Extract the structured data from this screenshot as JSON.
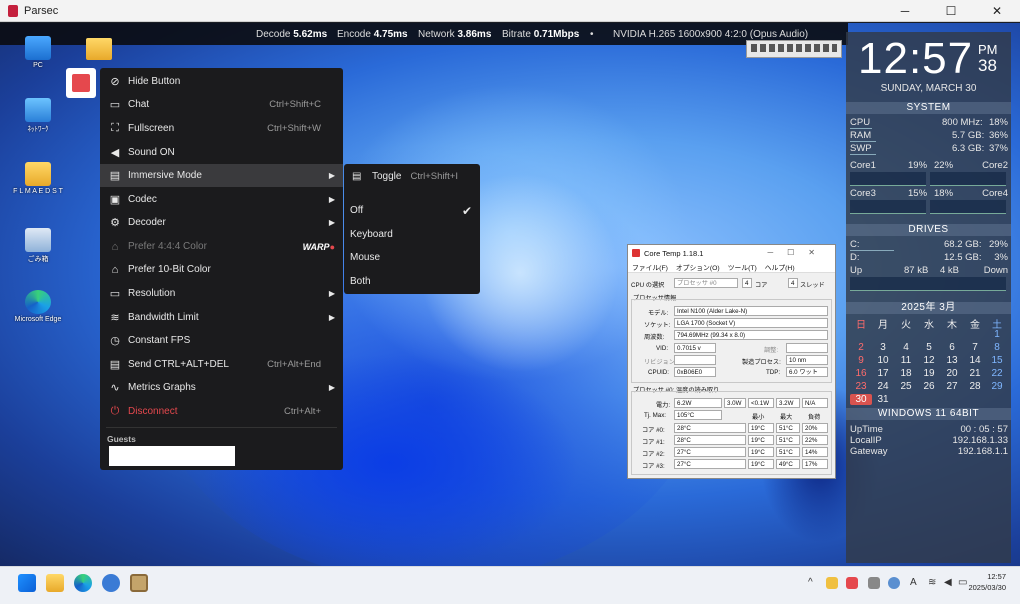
{
  "window": {
    "title": "Parsec",
    "minimize": "─",
    "maximize": "☐",
    "close": "✕"
  },
  "stats": {
    "decode_label": "Decode",
    "decode_value": "5.62ms",
    "encode_label": "Encode",
    "encode_value": "4.75ms",
    "network_label": "Network",
    "network_value": "3.86ms",
    "bitrate_label": "Bitrate",
    "bitrate_value": "0.71Mbps",
    "bullet": "•",
    "codec_info": "NVIDIA H.265 1600x900 4:2:0 (Opus Audio)"
  },
  "desktop_icons": [
    {
      "label": "PC"
    },
    {
      "label": "ﾈｯﾄﾜｰｸ"
    },
    {
      "label": "F L M A E D S T"
    },
    {
      "label": "ごみ箱"
    },
    {
      "label": "Microsoft Edge"
    }
  ],
  "menu": {
    "items": [
      {
        "label": "Hide Button",
        "shortcut": "",
        "icon": "eye-slash-icon"
      },
      {
        "label": "Chat",
        "shortcut": "Ctrl+Shift+C",
        "icon": "chat-icon"
      },
      {
        "label": "Fullscreen",
        "shortcut": "Ctrl+Shift+W",
        "icon": "fullscreen-icon"
      },
      {
        "label": "Sound ON",
        "shortcut": "",
        "icon": "speaker-icon"
      },
      {
        "label": "Immersive Mode",
        "shortcut": "",
        "icon": "keyboard-icon"
      },
      {
        "label": "Codec",
        "shortcut": "",
        "icon": "chip-icon"
      },
      {
        "label": "Decoder",
        "shortcut": "",
        "icon": "gear-icon"
      },
      {
        "label": "Prefer 4:4:4 Color",
        "shortcut": "",
        "icon": "palette-icon"
      },
      {
        "label": "Prefer 10-Bit Color",
        "shortcut": "",
        "icon": "palette-icon"
      },
      {
        "label": "Resolution",
        "shortcut": "",
        "icon": "monitor-icon"
      },
      {
        "label": "Bandwidth Limit",
        "shortcut": "",
        "icon": "wifi-icon"
      },
      {
        "label": "Constant FPS",
        "shortcut": "",
        "icon": "clock-icon"
      },
      {
        "label": "Send CTRL+ALT+DEL",
        "shortcut": "Ctrl+Alt+End",
        "icon": "keyboard-icon"
      },
      {
        "label": "Metrics Graphs",
        "shortcut": "",
        "icon": "graph-icon"
      },
      {
        "label": "Disconnect",
        "shortcut": "Ctrl+Alt+",
        "icon": "disconnect-icon"
      }
    ],
    "arrow": "▶",
    "warp_text": "WARP",
    "guests_label": "Guests"
  },
  "submenu": {
    "toggle_label": "Toggle",
    "toggle_shortcut": "Ctrl+Shift+I",
    "options": [
      "Off",
      "Keyboard",
      "Mouse",
      "Both"
    ],
    "checkmark": "✔"
  },
  "coretemp": {
    "title": "Core Temp 1.18.1",
    "menus": [
      "ファイル(F)",
      "オプション(O)",
      "ツール(T)",
      "ヘルプ(H)"
    ],
    "cpu_select_label": "CPU の選択",
    "cpu_select_value": "プロセッサ #0",
    "cores_value": "4",
    "cores_label": "コア",
    "threads_value": "4",
    "threads_label": "スレッド",
    "proc_info_label": "プロセッサ情報",
    "model_label": "モデル:",
    "model_value": "Intel N100 (Alder Lake-N)",
    "socket_label": "ソケット:",
    "socket_value": "LGA 1700 (Socket V)",
    "freq_label": "周波数:",
    "freq_value": "794.69MHz (99.34 x 8.0)",
    "vid_label": "VID:",
    "vid_value": "0.7015 v",
    "adjust_label": "調整:",
    "revision_label": "リビジョン:",
    "process_label": "製造プロセス:",
    "process_value": "10 nm",
    "cpuid_label": "CPUID:",
    "cpuid_value": "0xB06E0",
    "tdp_label": "TDP:",
    "tdp_value": "6.0 ワット",
    "temp_label": "プロセッサ #0: 温度の読み取り",
    "power_label": "電力:",
    "power_value": "6.2W",
    "p2": "3.0W",
    "p3": "<0.1W",
    "p4": "3.2W",
    "p5": "N/A",
    "tjmax_label": "Tj. Max:",
    "tjmax_value": "105°C",
    "min_label": "最小",
    "max_label": "最大",
    "load_label": "負荷",
    "cores": [
      {
        "label": "コア #0:",
        "temp": "28°C",
        "min": "19°C",
        "max": "51°C",
        "load": "20%"
      },
      {
        "label": "コア #1:",
        "temp": "28°C",
        "min": "19°C",
        "max": "51°C",
        "load": "22%"
      },
      {
        "label": "コア #2:",
        "temp": "27°C",
        "min": "19°C",
        "max": "51°C",
        "load": "14%"
      },
      {
        "label": "コア #3:",
        "temp": "27°C",
        "min": "19°C",
        "max": "49°C",
        "load": "17%"
      }
    ]
  },
  "rainmeter": {
    "time": "12:57",
    "ampm": "PM",
    "seconds": "38",
    "date": "SUNDAY, MARCH 30",
    "system_header": "SYSTEM",
    "cpu_label": "CPU",
    "cpu_freq": "800 MHz:",
    "cpu_pct": "18%",
    "ram_label": "RAM",
    "ram_val": "5.7 GB:",
    "ram_pct": "36%",
    "swp_label": "SWP",
    "swp_val": "6.3 GB:",
    "swp_pct": "37%",
    "core1_label": "Core1",
    "core1_pct": "19%",
    "core2_pct": "22%",
    "core2_label": "Core2",
    "core3_label": "Core3",
    "core3_pct": "15%",
    "core4_pct": "18%",
    "core4_label": "Core4",
    "drives_header": "DRIVES",
    "c_label": "C:",
    "c_val": "68.2 GB:",
    "c_pct": "29%",
    "d_label": "D:",
    "d_val": "12.5 GB:",
    "d_pct": "3%",
    "up_label": "Up",
    "up_val": "87 kB",
    "down_val": "4 kB",
    "down_label": "Down",
    "cal_title": "2025年 3月",
    "weekdays": [
      "日",
      "月",
      "火",
      "水",
      "木",
      "金",
      "土"
    ],
    "weeks": [
      [
        "",
        "",
        "",
        "",
        "",
        "",
        "1"
      ],
      [
        "2",
        "3",
        "4",
        "5",
        "6",
        "7",
        "8"
      ],
      [
        "9",
        "10",
        "11",
        "12",
        "13",
        "14",
        "15"
      ],
      [
        "16",
        "17",
        "18",
        "19",
        "20",
        "21",
        "22"
      ],
      [
        "23",
        "24",
        "25",
        "26",
        "27",
        "28",
        "29"
      ],
      [
        "30",
        "31",
        "",
        "",
        "",
        "",
        ""
      ]
    ],
    "os_header": "WINDOWS 11 64BIT",
    "uptime_label": "UpTime",
    "uptime_value": "00 : 05 : 57",
    "localip_label": "LocalIP",
    "localip_value": "192.168.1.33",
    "gateway_label": "Gateway",
    "gateway_value": "192.168.1.1"
  },
  "taskbar": {
    "time": "12:57",
    "date": "2025/03/30",
    "chevron": "^",
    "ime": "A"
  },
  "colors": {
    "accent": "#e5484d",
    "menu_bg": "#1b1b1d",
    "wallpaper": "#2a6ad8"
  }
}
